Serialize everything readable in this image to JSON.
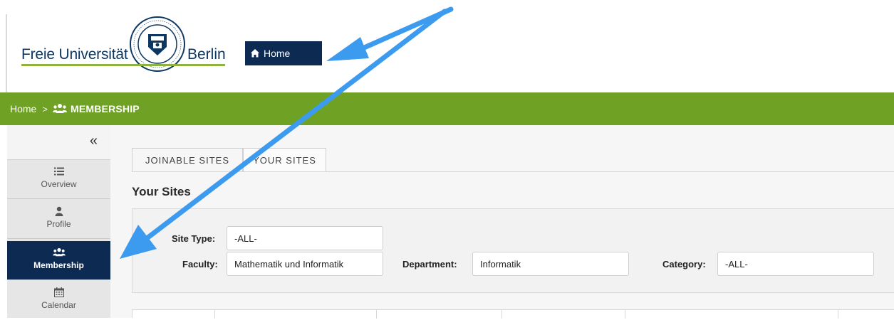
{
  "header": {
    "logo": {
      "left_text": "Freie Universität",
      "right_text": "Berlin",
      "seal_icon": "university-seal-icon",
      "seal_lettering": "VERITAS JUSTITIA LIBERTAS FREIE UNIVERSITÄT BERLIN"
    },
    "home_tab": {
      "label": "Home",
      "icon": "home-icon"
    }
  },
  "breadcrumb": {
    "home": "Home",
    "separator": ">",
    "current": "MEMBERSHIP",
    "current_icon": "users-icon"
  },
  "sidebar": {
    "collapse_glyph": "«",
    "items": [
      {
        "label": "Overview",
        "icon": "list-icon",
        "active": false
      },
      {
        "label": "Profile",
        "icon": "user-icon",
        "active": false
      },
      {
        "label": "Membership",
        "icon": "users-icon",
        "active": true
      },
      {
        "label": "Calendar",
        "icon": "calendar-icon",
        "active": false
      }
    ]
  },
  "main": {
    "tabs": [
      {
        "label": "JOINABLE SITES",
        "active": false
      },
      {
        "label": "YOUR SITES",
        "active": true
      }
    ],
    "section_title": "Your Sites",
    "filters": {
      "site_type": {
        "label": "Site Type:",
        "value": "-ALL-"
      },
      "faculty": {
        "label": "Faculty:",
        "value": "Mathematik und Informatik"
      },
      "department": {
        "label": "Department:",
        "value": "Informatik"
      },
      "category": {
        "label": "Category:",
        "value": "-ALL-"
      }
    }
  },
  "colors": {
    "brand_navy": "#0d2a52",
    "breadcrumb_green": "#6ea124",
    "annotation_arrow": "#3d9bef"
  }
}
